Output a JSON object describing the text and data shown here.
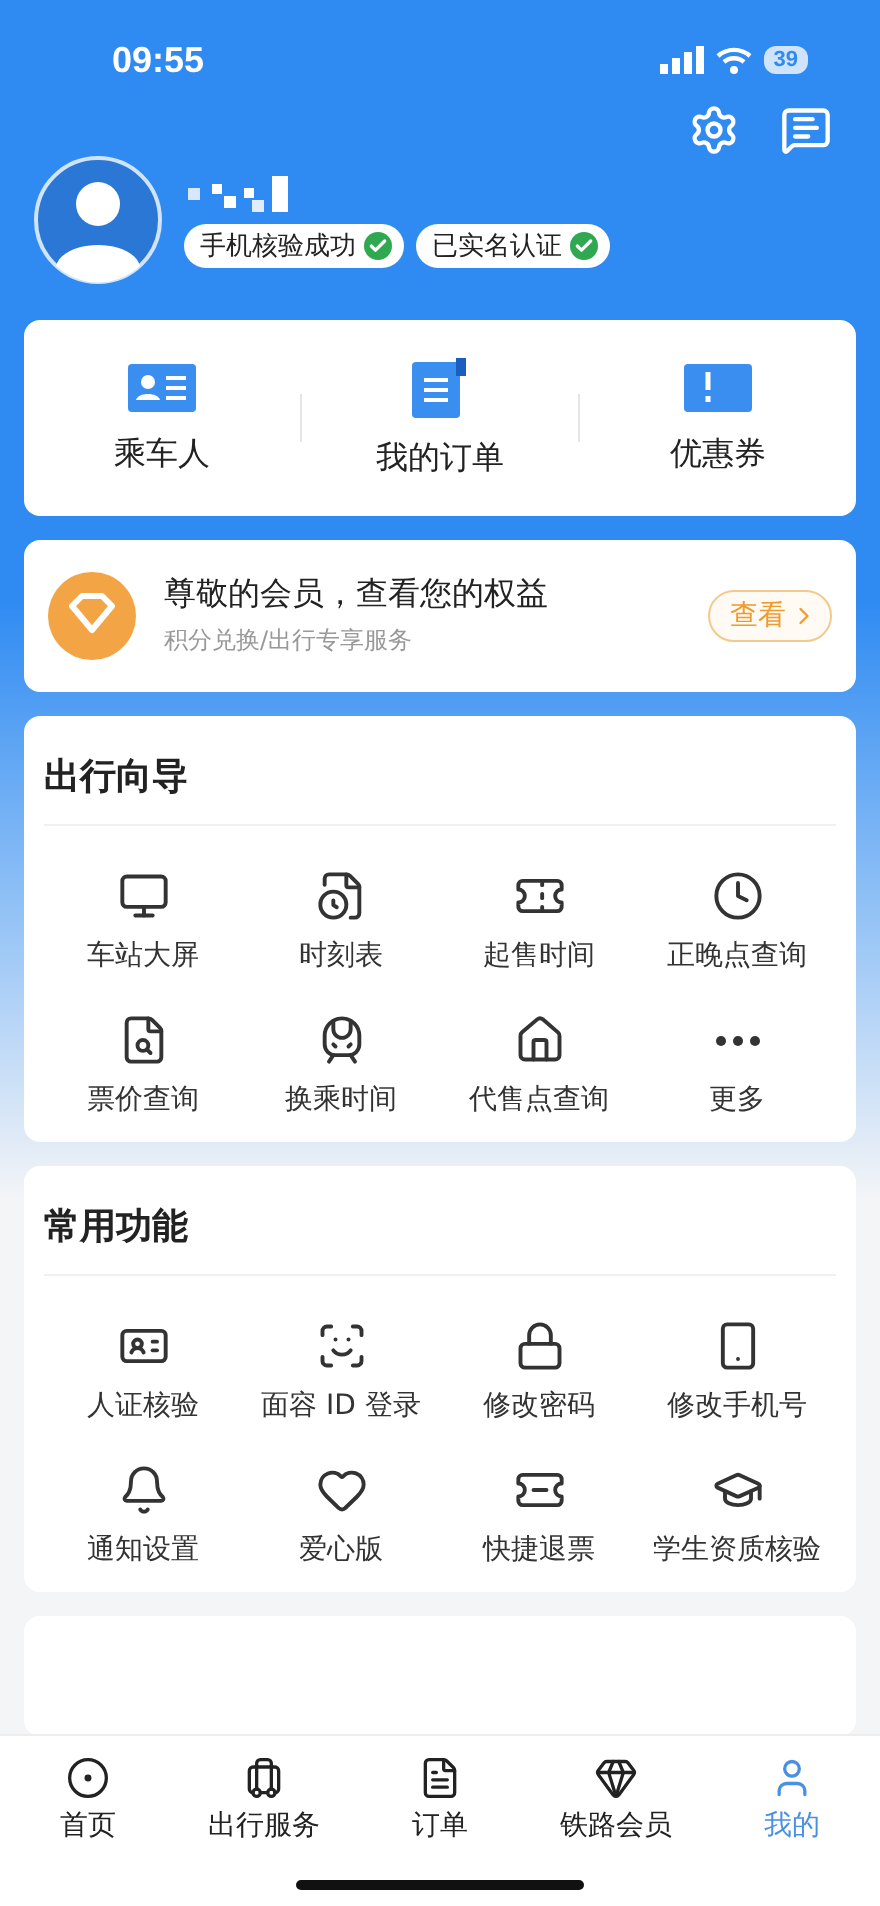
{
  "status_bar": {
    "time": "09:55",
    "battery": "39"
  },
  "profile": {
    "badges": [
      {
        "label": "手机核验成功",
        "verified": true
      },
      {
        "label": "已实名认证",
        "verified": true
      }
    ]
  },
  "quick_links": [
    {
      "label": "乘车人"
    },
    {
      "label": "我的订单"
    },
    {
      "label": "优惠券"
    }
  ],
  "member_banner": {
    "title": "尊敬的会员，查看您的权益",
    "subtitle": "积分兑换/出行专享服务",
    "button": "查看"
  },
  "sections": [
    {
      "title": "出行向导",
      "items": [
        "车站大屏",
        "时刻表",
        "起售时间",
        "正晚点查询",
        "票价查询",
        "换乘时间",
        "代售点查询",
        "更多"
      ]
    },
    {
      "title": "常用功能",
      "items": [
        "人证核验",
        "面容 ID 登录",
        "修改密码",
        "修改手机号",
        "通知设置",
        "爱心版",
        "快捷退票",
        "学生资质核验"
      ]
    }
  ],
  "tab_bar": [
    {
      "label": "首页",
      "selected": false
    },
    {
      "label": "出行服务",
      "selected": false
    },
    {
      "label": "订单",
      "selected": false
    },
    {
      "label": "铁路会员",
      "selected": false
    },
    {
      "label": "我的",
      "selected": true
    }
  ]
}
